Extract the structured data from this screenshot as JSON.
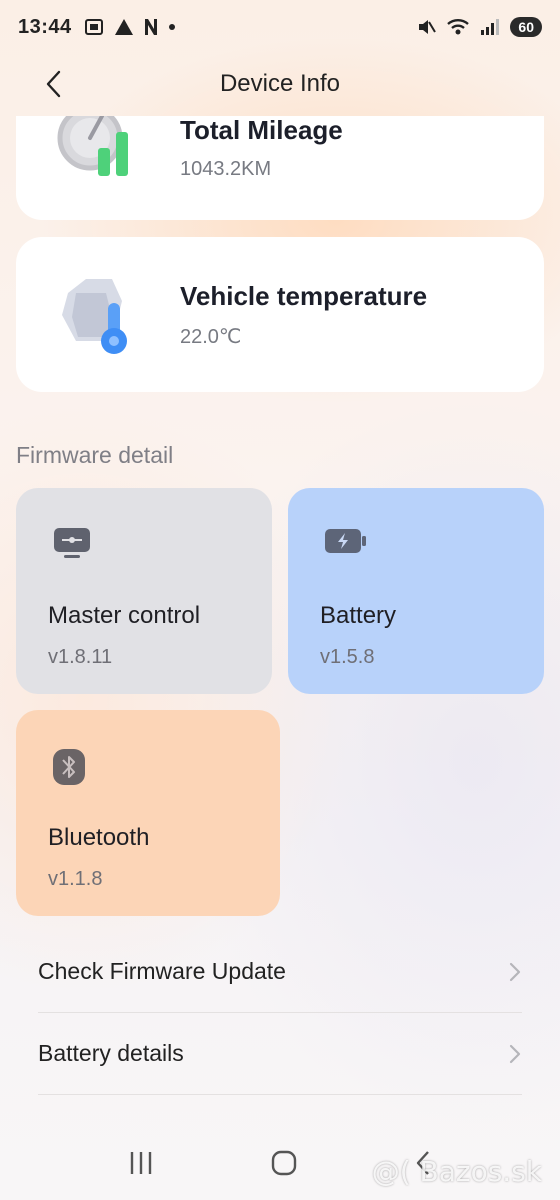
{
  "status_bar": {
    "time": "13:44",
    "battery": "60"
  },
  "header": {
    "title": "Device Info"
  },
  "stats": [
    {
      "title": "Total Mileage",
      "value": "1043.2KM"
    },
    {
      "title": "Vehicle temperature",
      "value": "22.0℃"
    }
  ],
  "firmware": {
    "section_label": "Firmware detail",
    "items": [
      {
        "name": "Master control",
        "version": "v1.8.11",
        "icon": "monitor-icon",
        "color": "#e1e1e5"
      },
      {
        "name": "Battery",
        "version": "v1.5.8",
        "icon": "battery-icon",
        "color": "#b8d2fa"
      },
      {
        "name": "Bluetooth",
        "version": "v1.1.8",
        "icon": "bluetooth-icon",
        "color": "#fcd5b7"
      }
    ]
  },
  "actions": [
    {
      "label": "Check Firmware Update"
    },
    {
      "label": "Battery details"
    }
  ],
  "watermark": "@( Bazos.sk"
}
